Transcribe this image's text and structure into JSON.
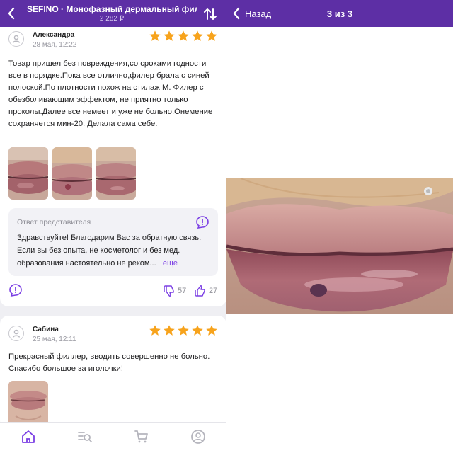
{
  "header": {
    "product_title": "SEFINO · Монофазный дермальный фил...",
    "price": "2 282 ₽"
  },
  "reviews": [
    {
      "author": "Александра",
      "date": "28 мая, 12:22",
      "rating": 5,
      "text": "Товар пришел без повреждения,со сроками годности все в порядке.Пока все отлично,филер брала с синей полоской.По плотности похож на стилаж М. Филер с обезболивающим эффектом, не приятно только проколы.Далее все немеет и уже не больно.Онемение сохраняется мин-20. Делала сама себе.",
      "answer": {
        "title": "Ответ представителя",
        "text": "Здравствуйте! Благодарим Вас за обратную связь. Если вы без опыта, не косметолог и без мед. образования настоятельно не реком...",
        "more": "еще"
      },
      "dislikes": "57",
      "likes": "27"
    },
    {
      "author": "Сабина",
      "date": "25 мая, 12:11",
      "rating": 5,
      "text": "Прекрасный филлер, вводить совершенно не больно. Спасибо большое за иголочки!"
    }
  ],
  "viewer": {
    "back_label": "Назад",
    "counter": "3 из 3"
  },
  "colors": {
    "accent": "#5d2fa5",
    "star": "#f7a31c",
    "link": "#7b3fe4"
  }
}
